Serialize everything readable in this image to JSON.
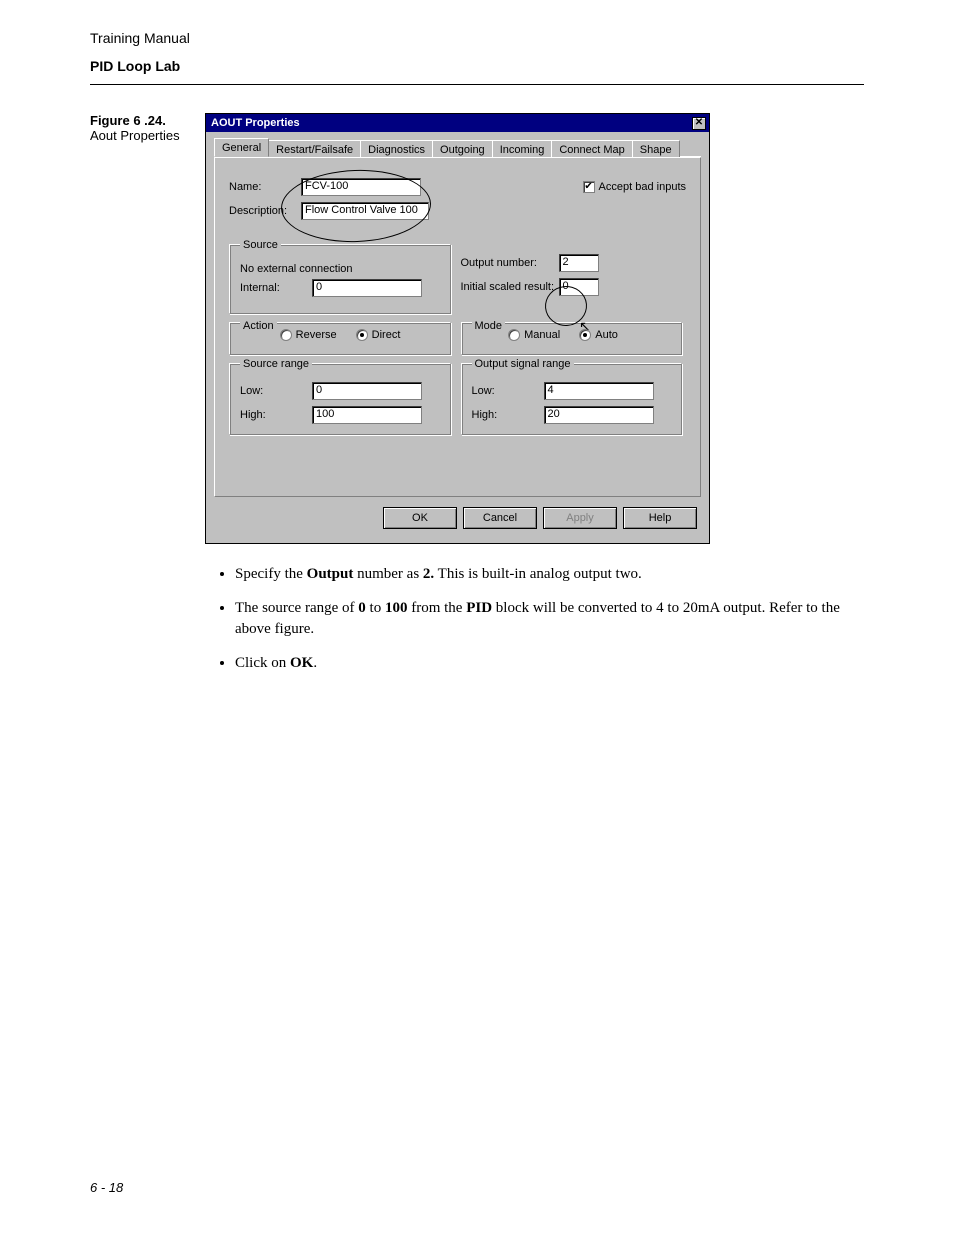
{
  "header": {
    "line1": "Training Manual",
    "line2": "PID Loop Lab"
  },
  "figure": {
    "label": "Figure 6 .24.",
    "desc": "Aout Properties"
  },
  "dialog": {
    "title": "AOUT Properties",
    "close": "✕",
    "tabs": [
      "General",
      "Restart/Failsafe",
      "Diagnostics",
      "Outgoing",
      "Incoming",
      "Connect Map",
      "Shape"
    ],
    "name_label": "Name:",
    "name_value": "FCV-100",
    "desc_label": "Description:",
    "desc_value": "Flow Control Valve 100",
    "accept_bad": "Accept bad inputs",
    "accept_bad_checked": "✔",
    "source_legend": "Source",
    "no_external": "No external connection",
    "internal_label": "Internal:",
    "internal_value": "0",
    "output_number_label": "Output number:",
    "output_number_value": "2",
    "initial_scaled_label": "Initial scaled result:",
    "initial_scaled_value": "0",
    "action_legend": "Action",
    "action_reverse": "Reverse",
    "action_direct": "Direct",
    "mode_legend": "Mode",
    "mode_manual": "Manual",
    "mode_auto": "Auto",
    "src_range_legend": "Source range",
    "out_range_legend": "Output signal range",
    "low_label": "Low:",
    "high_label": "High:",
    "src_low": "0",
    "src_high": "100",
    "out_low": "4",
    "out_high": "20",
    "btn_ok": "OK",
    "btn_cancel": "Cancel",
    "btn_apply": "Apply",
    "btn_help": "Help"
  },
  "bullets": {
    "b1_pre": "Specify the ",
    "b1_bold1": "Output",
    "b1_mid": " number as ",
    "b1_bold2": "2.",
    "b1_post": " This is built-in analog output two.",
    "b2_pre": "The source range of ",
    "b2_bold1": "0",
    "b2_mid1": " to ",
    "b2_bold2": "100",
    "b2_mid2": " from the ",
    "b2_bold3": "PID",
    "b2_post": " block will be converted to 4 to 20mA output. Refer to the above figure.",
    "b3_pre": "Click on ",
    "b3_bold": "OK",
    "b3_post": "."
  },
  "footer": {
    "page": "6 - 18"
  }
}
